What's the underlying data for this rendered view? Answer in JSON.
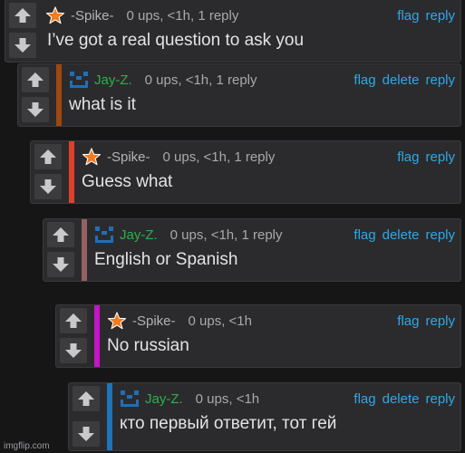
{
  "labels": {
    "flag": "flag",
    "delete": "delete",
    "reply": "reply"
  },
  "colors": {
    "spike_name": "#b3b3b6",
    "jay_name": "#2cb04b",
    "link": "#2fa8e6",
    "bar_brown": "#a0460f",
    "bar_red": "#e0402b",
    "bar_mauve": "#93615f",
    "bar_magenta": "#c415c6",
    "bar_blue": "#1f73b7"
  },
  "comments": [
    {
      "user": "-Spike-",
      "meta": "0 ups, <1h, 1 reply",
      "text": "I’ve got a real question to ask you",
      "avatar_icon": "star-icon"
    },
    {
      "user": "Jay-Z.",
      "meta": "0 ups, <1h, 1 reply",
      "text": "what is it",
      "avatar_icon": "pixel-face-icon"
    },
    {
      "user": "-Spike-",
      "meta": "0 ups, <1h, 1 reply",
      "text": "Guess what",
      "avatar_icon": "star-icon"
    },
    {
      "user": "Jay-Z.",
      "meta": "0 ups, <1h, 1 reply",
      "text": "English or Spanish",
      "avatar_icon": "pixel-face-icon"
    },
    {
      "user": "-Spike-",
      "meta": "0 ups, <1h",
      "text": "No russian",
      "avatar_icon": "star-icon"
    },
    {
      "user": "Jay-Z.",
      "meta": "0 ups, <1h",
      "text": "кто первый ответит, тот гей",
      "avatar_icon": "pixel-face-icon"
    }
  ],
  "watermark": "imgflip.com"
}
